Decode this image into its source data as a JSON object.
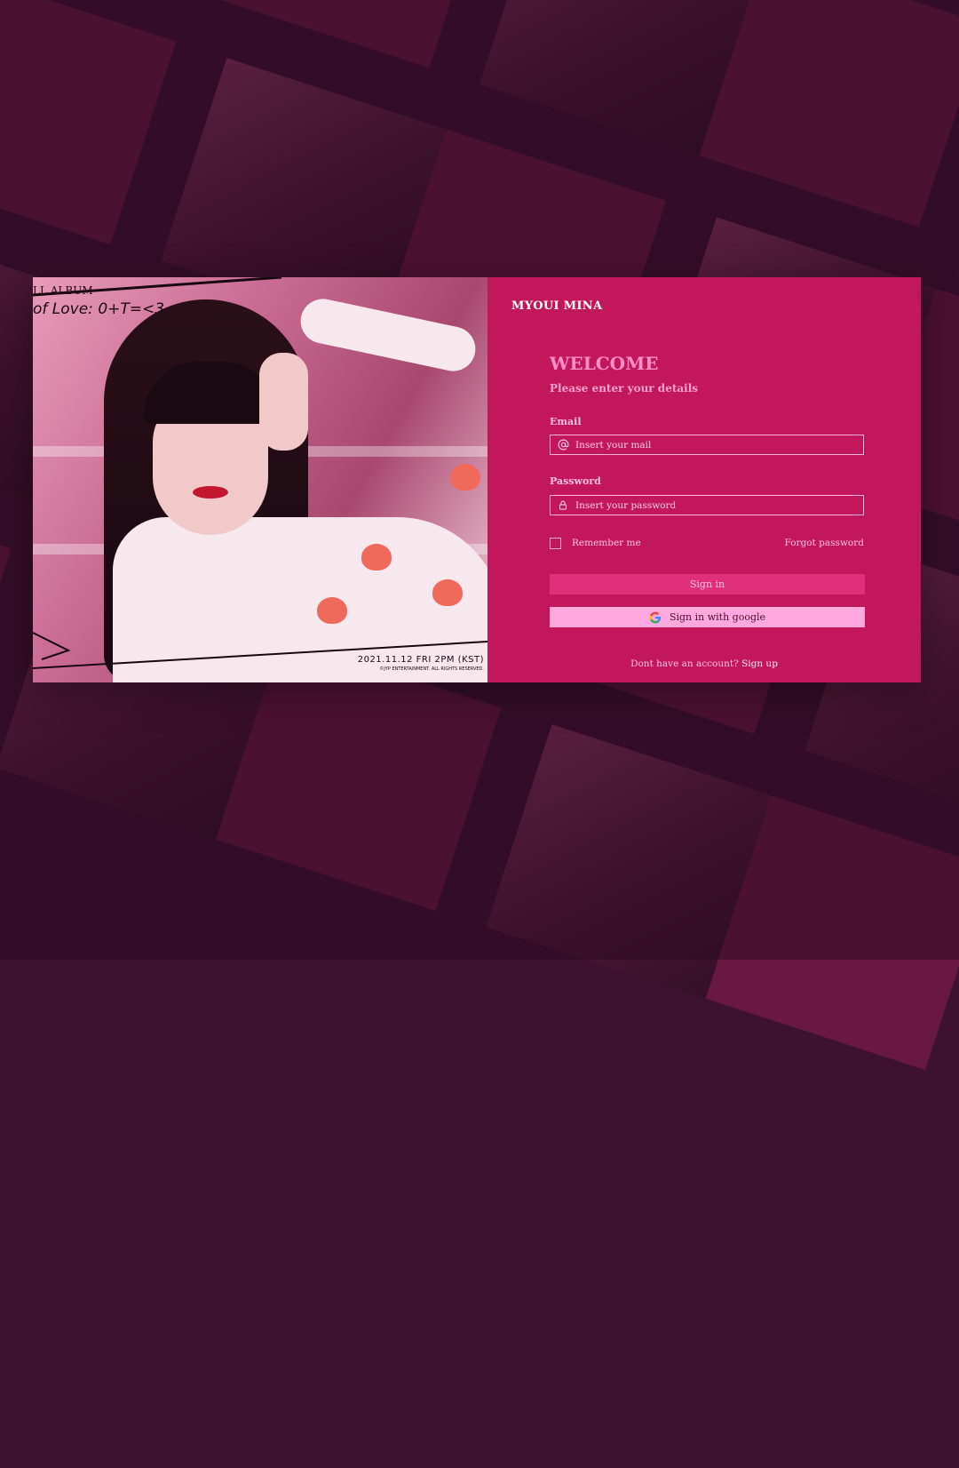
{
  "photo": {
    "album_title": "LL ALBUM",
    "album_subtitle": "of Love: 0+T=<3",
    "release_date": "2021.11.12 FRI 2PM (KST)",
    "copyright": "©JYP ENTERTAINMENT. ALL RIGHTS RESERVED."
  },
  "form": {
    "brand": "MYOUI MINA",
    "welcome": "WELCOME",
    "subtitle": "Please enter your details",
    "email": {
      "label": "Email",
      "placeholder": "Insert your mail",
      "value": "",
      "icon": "at-icon"
    },
    "password": {
      "label": "Password",
      "placeholder": "Insert your password",
      "value": "",
      "icon": "lock-icon"
    },
    "remember_label": "Remember me",
    "remember_checked": false,
    "forgot_label": "Forgot password",
    "signin_label": "Sign in",
    "google_label": "Sign in with google",
    "google_icon": "google-icon",
    "signup_prompt": "Dont have an account?",
    "signup_label": "Sign up"
  },
  "colors": {
    "page_background": "#3d1230",
    "form_background": "#c2185b",
    "accent_heading": "#ff8ec6",
    "signin_button": "#e0307a",
    "google_button": "#ffa8e0"
  }
}
